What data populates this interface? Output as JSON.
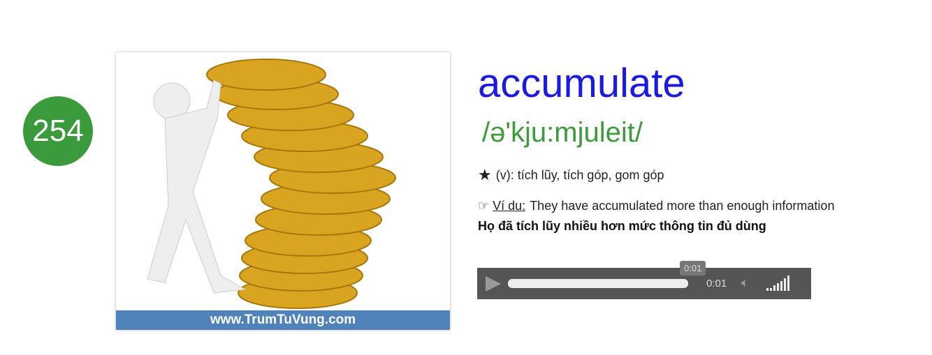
{
  "number": "254",
  "image": {
    "banner": "www.TrumTuVung.com"
  },
  "word": "accumulate",
  "phonetic": "/ə'kju:mjuleit/",
  "meaning": "(v): tích lũy, tích góp, gom góp",
  "example": {
    "label": "Ví du:",
    "text": "They have accumulated more than enough information"
  },
  "translation": "Họ đã tích lũy nhiều hơn mức thông tin đủ dùng",
  "player": {
    "tooltip": "0:01",
    "time": "0:01",
    "progress": 0.97,
    "volume_level": 1.0
  }
}
